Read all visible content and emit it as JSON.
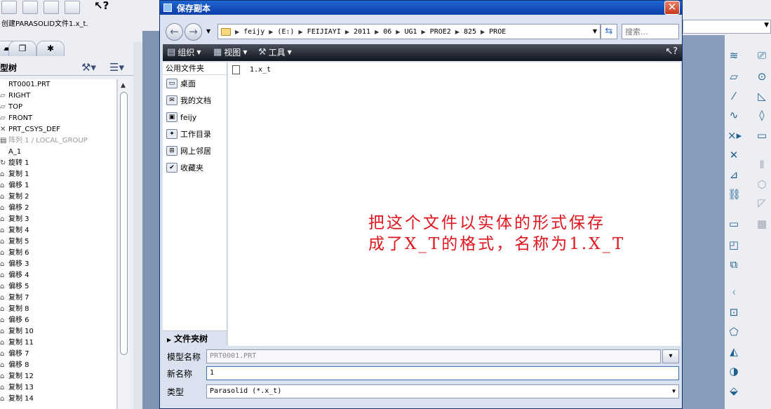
{
  "background_app": {
    "status_text": "创建PARASOLID文件1.x_t.",
    "tree_title": "型树",
    "tree_items": [
      {
        "icon": "",
        "label": "RT0001.PRT",
        "dim": false
      },
      {
        "icon": "▱",
        "label": "RIGHT",
        "dim": false
      },
      {
        "icon": "▱",
        "label": "TOP",
        "dim": false
      },
      {
        "icon": "▱",
        "label": "FRONT",
        "dim": false
      },
      {
        "icon": "✕",
        "label": "PRT_CSYS_DEF",
        "dim": false
      },
      {
        "icon": "▤",
        "label": "阵列 1 / LOCAL_GROUP",
        "dim": true
      },
      {
        "icon": "",
        "label": "A_1",
        "dim": false
      },
      {
        "icon": "↻",
        "label": "旋转 1",
        "dim": false
      },
      {
        "icon": "⌂",
        "label": "复制 1",
        "dim": false
      },
      {
        "icon": "⌂",
        "label": "偏移 1",
        "dim": false
      },
      {
        "icon": "⌂",
        "label": "复制 2",
        "dim": false
      },
      {
        "icon": "⌂",
        "label": "偏移 2",
        "dim": false
      },
      {
        "icon": "⌂",
        "label": "复制 3",
        "dim": false
      },
      {
        "icon": "⌂",
        "label": "复制 4",
        "dim": false
      },
      {
        "icon": "⌂",
        "label": "复制 5",
        "dim": false
      },
      {
        "icon": "⌂",
        "label": "复制 6",
        "dim": false
      },
      {
        "icon": "⌂",
        "label": "偏移 3",
        "dim": false
      },
      {
        "icon": "⌂",
        "label": "偏移 4",
        "dim": false
      },
      {
        "icon": "⌂",
        "label": "偏移 5",
        "dim": false
      },
      {
        "icon": "⌂",
        "label": "复制 7",
        "dim": false
      },
      {
        "icon": "⌂",
        "label": "复制 8",
        "dim": false
      },
      {
        "icon": "⌂",
        "label": "偏移 6",
        "dim": false
      },
      {
        "icon": "⌂",
        "label": "复制 10",
        "dim": false
      },
      {
        "icon": "⌂",
        "label": "复制 11",
        "dim": false
      },
      {
        "icon": "⌂",
        "label": "偏移 7",
        "dim": false
      },
      {
        "icon": "⌂",
        "label": "偏移 8",
        "dim": false
      },
      {
        "icon": "⌂",
        "label": "复制 12",
        "dim": false
      },
      {
        "icon": "⌂",
        "label": "复制 13",
        "dim": false
      },
      {
        "icon": "⌂",
        "label": "复制 14",
        "dim": false
      }
    ]
  },
  "dialog": {
    "title": "保存副本",
    "close_glyph": "✕",
    "address": {
      "crumbs": [
        "feijy",
        "(E:)",
        "FEIJIAYI",
        "2011",
        "06",
        "UG1",
        "PROE2",
        "825",
        "PROE"
      ]
    },
    "search": {
      "placeholder": "搜索..."
    },
    "commands": {
      "organize": "组织",
      "view": "视图",
      "tools": "工具"
    },
    "places_header": "公用文件夹",
    "places": [
      {
        "icon": "desktop-icon",
        "label": "桌面"
      },
      {
        "icon": "documents-icon",
        "label": "我的文档"
      },
      {
        "icon": "computer-icon",
        "label": "feijy"
      },
      {
        "icon": "work-dir-icon",
        "label": "工作目录"
      },
      {
        "icon": "network-icon",
        "label": "网上邻居"
      },
      {
        "icon": "favorites-icon",
        "label": "收藏夹"
      }
    ],
    "folder_tree_label": "文件夹树",
    "files": [
      {
        "name": "1.x_t"
      }
    ],
    "annotation": "把这个文件以实体的形式保存\n成了X_T的格式，名称为1.X_T",
    "form": {
      "model_name_label": "模型名称",
      "model_name_value": "PRT0001.PRT",
      "new_name_label": "新名称",
      "new_name_value": "1",
      "type_label": "类型",
      "type_value": "Parasolid (*.x_t)"
    }
  },
  "colors": {
    "titlebar": "#1f66d1",
    "annotation": "#e0161e",
    "cmdbar": "#2a2f3a"
  }
}
